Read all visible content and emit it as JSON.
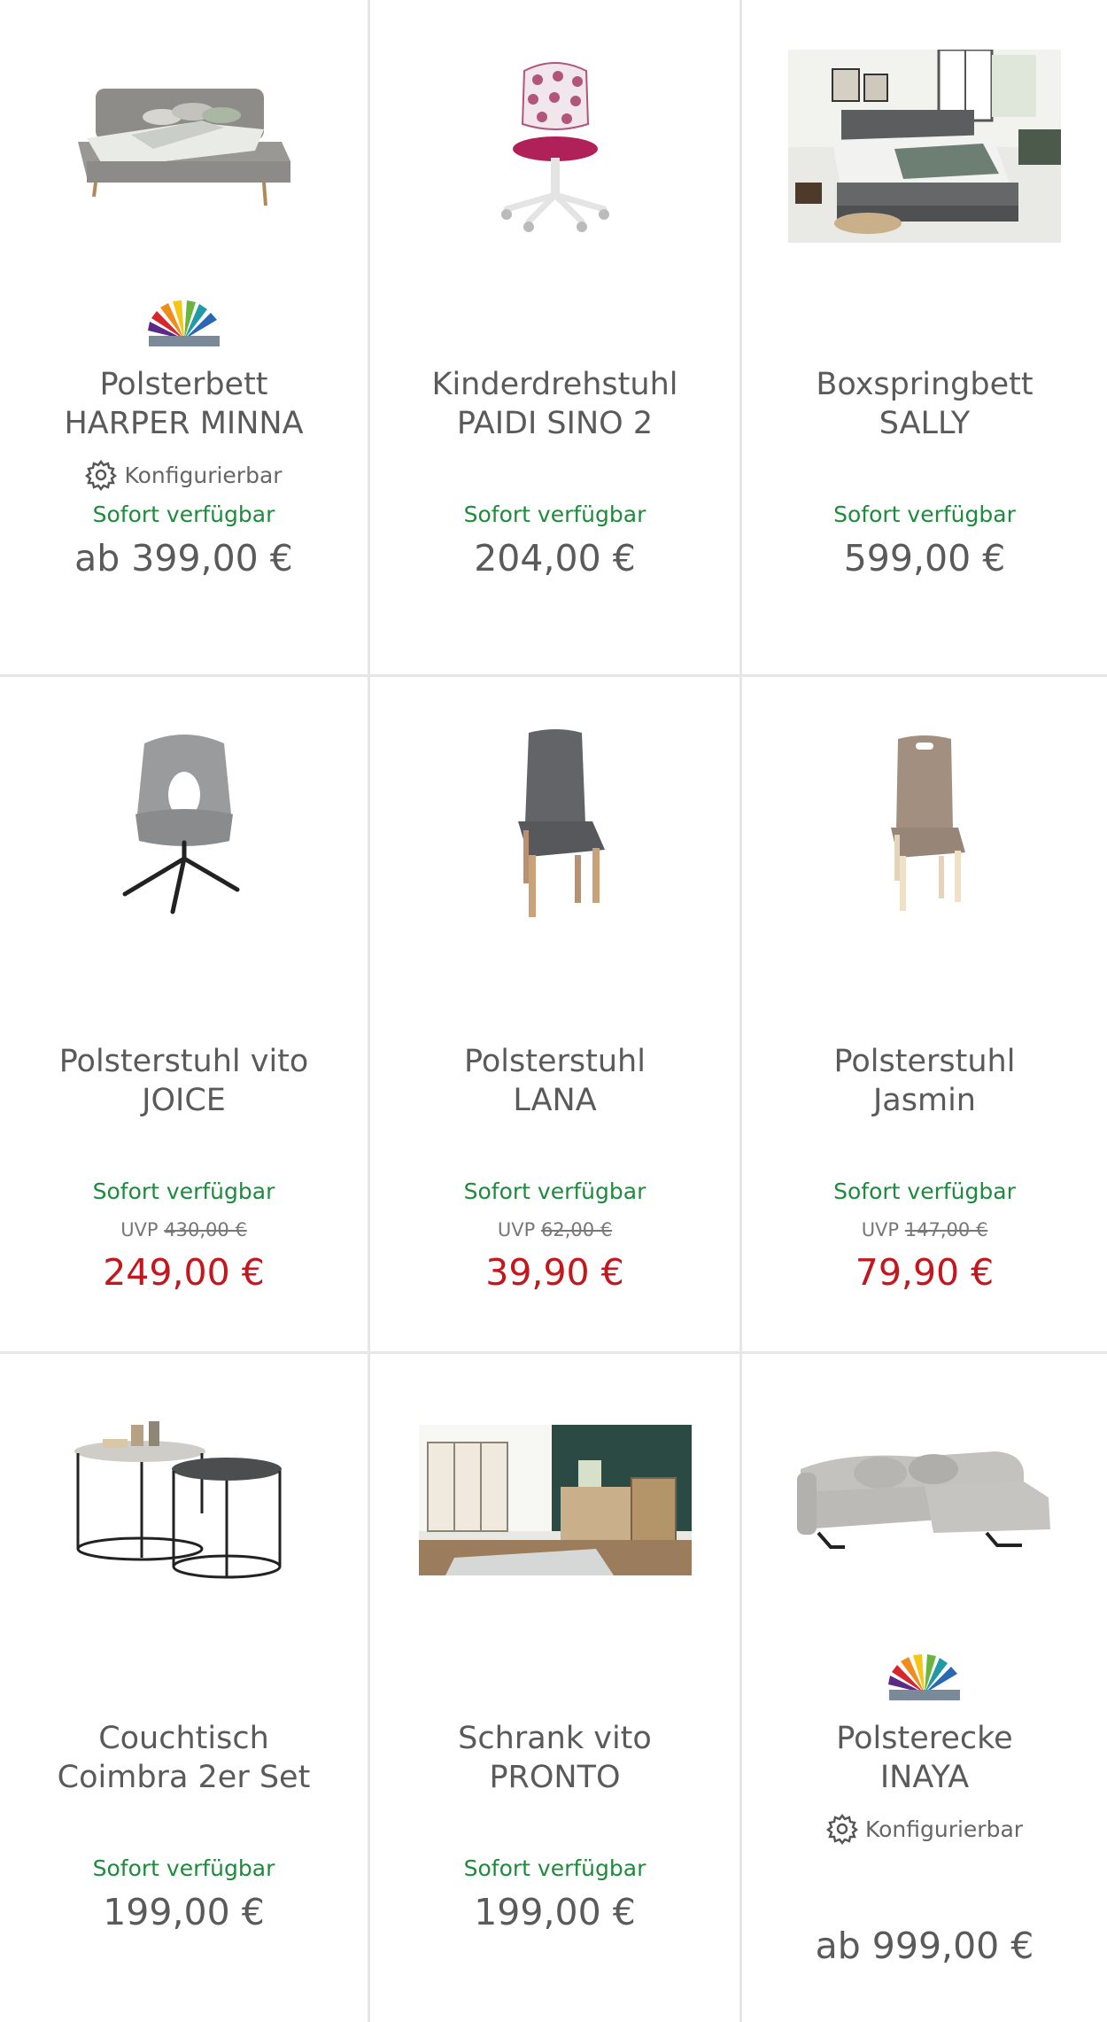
{
  "products": [
    {
      "line1": "Polsterbett",
      "line2": "HARPER MINNA",
      "config": "Konfigurierbar",
      "availability": "Sofort verfügbar",
      "price": "ab 399,00 €",
      "brand_icon": "rainbow-fan-logo"
    },
    {
      "line1": "Kinderdrehstuhl",
      "line2": "PAIDI SINO 2",
      "availability": "Sofort verfügbar",
      "price": "204,00 €"
    },
    {
      "line1": "Boxspringbett",
      "line2": "SALLY",
      "availability": "Sofort verfügbar",
      "price": "599,00 €"
    },
    {
      "line1": "Polsterstuhl vito",
      "line2": "JOICE",
      "availability": "Sofort verfügbar",
      "uvp_label": "UVP",
      "uvp_price": "430,00 €",
      "sale_price": "249,00 €"
    },
    {
      "line1": "Polsterstuhl",
      "line2": "LANA",
      "availability": "Sofort verfügbar",
      "uvp_label": "UVP",
      "uvp_price": "62,00 €",
      "sale_price": "39,90 €"
    },
    {
      "line1": "Polsterstuhl",
      "line2": "Jasmin",
      "availability": "Sofort verfügbar",
      "uvp_label": "UVP",
      "uvp_price": "147,00 €",
      "sale_price": "79,90 €"
    },
    {
      "line1": "Couchtisch",
      "line2": "Coimbra 2er Set",
      "availability": "Sofort verfügbar",
      "price": "199,00 €"
    },
    {
      "line1": "Schrank vito",
      "line2": "PRONTO",
      "availability": "Sofort verfügbar",
      "price": "199,00 €"
    },
    {
      "line1": "Polsterecke",
      "line2": "INAYA",
      "config": "Konfigurierbar",
      "price": "ab 999,00 €",
      "brand_icon": "rainbow-fan-logo"
    }
  ],
  "colors": {
    "availability": "#1e8a3c",
    "sale": "#c4161c",
    "text": "#5a5a5a",
    "divider": "#e6e6e6"
  }
}
